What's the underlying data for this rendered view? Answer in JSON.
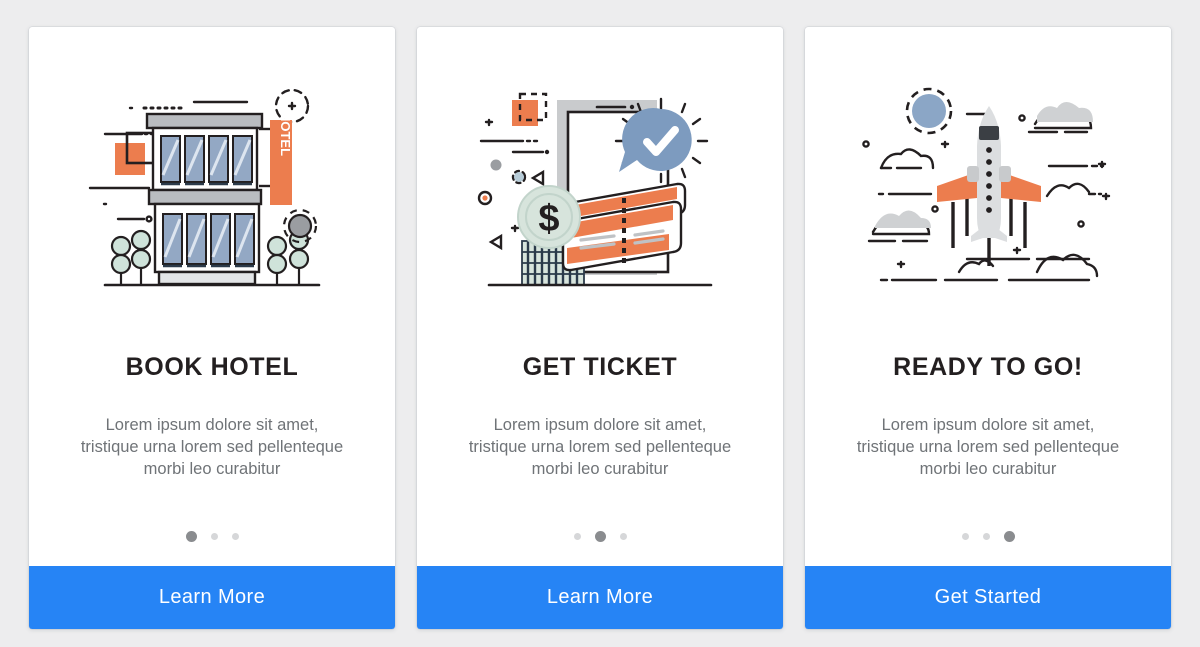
{
  "theme": {
    "page_background": "#ededee",
    "card_background": "#ffffff",
    "accent_blue": "#2684f5",
    "accent_orange": "#ec7d4e",
    "title_color": "#231f20",
    "body_color": "#6f7377",
    "dot_active_color": "#8a8c8f",
    "dot_inactive_color": "#d6d7d9",
    "window_blue": "#93a8c4",
    "coin_green": "#d7e4dc",
    "badge_blue": "#7d9bbf",
    "plane_gray": "#d9dadb"
  },
  "cards": [
    {
      "illustration_name": "hotel-building-illustration",
      "sign_label": "HOTEL",
      "title": "BOOK HOTEL",
      "body": "Lorem ipsum dolore sit amet,\ntristique urna lorem sed pellenteque\nmorbi leo curabitur",
      "dots": {
        "count": 3,
        "active_index": 0
      },
      "cta_label": "Learn More"
    },
    {
      "illustration_name": "ticket-payment-illustration",
      "currency_symbol": "$",
      "title": "GET TICKET",
      "body": "Lorem ipsum dolore sit amet,\ntristique urna lorem sed pellenteque\nmorbi leo curabitur",
      "dots": {
        "count": 3,
        "active_index": 1
      },
      "cta_label": "Learn More"
    },
    {
      "illustration_name": "airplane-takeoff-illustration",
      "title": "READY TO GO!",
      "body": "Lorem ipsum dolore sit amet,\ntristique urna lorem sed pellenteque\nmorbi leo curabitur",
      "dots": {
        "count": 3,
        "active_index": 2
      },
      "cta_label": "Get Started"
    }
  ]
}
